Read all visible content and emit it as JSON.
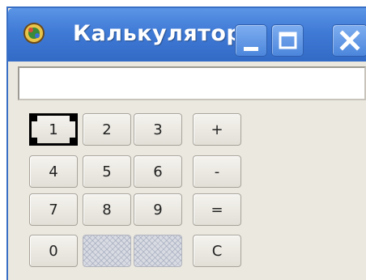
{
  "window": {
    "title": "Калькулятор",
    "app_icon": "calculator-app-icon"
  },
  "titlebar_buttons": {
    "minimize_icon": "minimize-icon",
    "maximize_icon": "maximize-icon",
    "close_icon": "close-icon"
  },
  "display": {
    "value": ""
  },
  "keys": {
    "k1": "1",
    "k2": "2",
    "k3": "3",
    "plus": "+",
    "k4": "4",
    "k5": "5",
    "k6": "6",
    "minus": "-",
    "k7": "7",
    "k8": "8",
    "k9": "9",
    "equals": "=",
    "k0": "0",
    "clear": "C"
  },
  "colors": {
    "titlebar": "#3f7ad6",
    "window_bg": "#ebe8e0"
  }
}
